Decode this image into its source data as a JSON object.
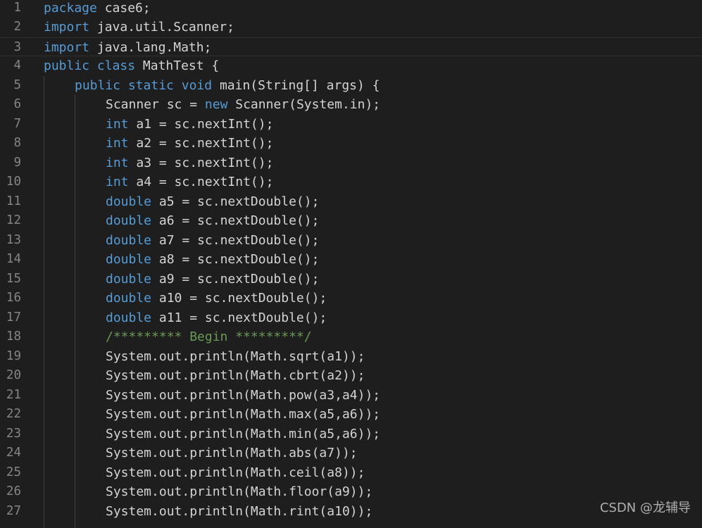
{
  "colors": {
    "background": "#1e1e1e",
    "keyword": "#569cd6",
    "text": "#d4d4d4",
    "comment": "#6a9955",
    "line_number": "#858585"
  },
  "current_line": 3,
  "lines": [
    {
      "n": "1",
      "indent": 0,
      "tokens": [
        {
          "t": "package",
          "k": "kw"
        },
        {
          "t": " case6;",
          "k": "plain"
        }
      ]
    },
    {
      "n": "2",
      "indent": 0,
      "tokens": [
        {
          "t": "import",
          "k": "kw"
        },
        {
          "t": " java.util.Scanner;",
          "k": "plain"
        }
      ]
    },
    {
      "n": "3",
      "indent": 0,
      "tokens": [
        {
          "t": "import",
          "k": "kw"
        },
        {
          "t": " java.lang.Math;",
          "k": "plain"
        }
      ]
    },
    {
      "n": "4",
      "indent": 0,
      "tokens": [
        {
          "t": "public",
          "k": "kw"
        },
        {
          "t": " ",
          "k": "plain"
        },
        {
          "t": "class",
          "k": "kw"
        },
        {
          "t": " MathTest {",
          "k": "plain"
        }
      ]
    },
    {
      "n": "5",
      "indent": 1,
      "tokens": [
        {
          "t": "public",
          "k": "kw"
        },
        {
          "t": " ",
          "k": "plain"
        },
        {
          "t": "static",
          "k": "kw"
        },
        {
          "t": " ",
          "k": "plain"
        },
        {
          "t": "void",
          "k": "kw"
        },
        {
          "t": " main(String[] args) {",
          "k": "plain"
        }
      ]
    },
    {
      "n": "6",
      "indent": 2,
      "tokens": [
        {
          "t": "Scanner sc = ",
          "k": "plain"
        },
        {
          "t": "new",
          "k": "kw"
        },
        {
          "t": " Scanner(System.in);",
          "k": "plain"
        }
      ]
    },
    {
      "n": "7",
      "indent": 2,
      "tokens": [
        {
          "t": "int",
          "k": "kw"
        },
        {
          "t": " a1 = sc.nextInt();",
          "k": "plain"
        }
      ]
    },
    {
      "n": "8",
      "indent": 2,
      "tokens": [
        {
          "t": "int",
          "k": "kw"
        },
        {
          "t": " a2 = sc.nextInt();",
          "k": "plain"
        }
      ]
    },
    {
      "n": "9",
      "indent": 2,
      "tokens": [
        {
          "t": "int",
          "k": "kw"
        },
        {
          "t": " a3 = sc.nextInt();",
          "k": "plain"
        }
      ]
    },
    {
      "n": "10",
      "indent": 2,
      "tokens": [
        {
          "t": "int",
          "k": "kw"
        },
        {
          "t": " a4 = sc.nextInt();",
          "k": "plain"
        }
      ]
    },
    {
      "n": "11",
      "indent": 2,
      "tokens": [
        {
          "t": "double",
          "k": "kw"
        },
        {
          "t": " a5 = sc.nextDouble();",
          "k": "plain"
        }
      ]
    },
    {
      "n": "12",
      "indent": 2,
      "tokens": [
        {
          "t": "double",
          "k": "kw"
        },
        {
          "t": " a6 = sc.nextDouble();",
          "k": "plain"
        }
      ]
    },
    {
      "n": "13",
      "indent": 2,
      "tokens": [
        {
          "t": "double",
          "k": "kw"
        },
        {
          "t": " a7 = sc.nextDouble();",
          "k": "plain"
        }
      ]
    },
    {
      "n": "14",
      "indent": 2,
      "tokens": [
        {
          "t": "double",
          "k": "kw"
        },
        {
          "t": " a8 = sc.nextDouble();",
          "k": "plain"
        }
      ]
    },
    {
      "n": "15",
      "indent": 2,
      "tokens": [
        {
          "t": "double",
          "k": "kw"
        },
        {
          "t": " a9 = sc.nextDouble();",
          "k": "plain"
        }
      ]
    },
    {
      "n": "16",
      "indent": 2,
      "tokens": [
        {
          "t": "double",
          "k": "kw"
        },
        {
          "t": " a10 = sc.nextDouble();",
          "k": "plain"
        }
      ]
    },
    {
      "n": "17",
      "indent": 2,
      "tokens": [
        {
          "t": "double",
          "k": "kw"
        },
        {
          "t": " a11 = sc.nextDouble();",
          "k": "plain"
        }
      ]
    },
    {
      "n": "18",
      "indent": 2,
      "tokens": [
        {
          "t": "/********* Begin *********/",
          "k": "comment"
        }
      ]
    },
    {
      "n": "19",
      "indent": 2,
      "tokens": [
        {
          "t": "System.out.println(Math.sqrt(a1));",
          "k": "plain"
        }
      ]
    },
    {
      "n": "20",
      "indent": 2,
      "tokens": [
        {
          "t": "System.out.println(Math.cbrt(a2));",
          "k": "plain"
        }
      ]
    },
    {
      "n": "21",
      "indent": 2,
      "tokens": [
        {
          "t": "System.out.println(Math.pow(a3,a4));",
          "k": "plain"
        }
      ]
    },
    {
      "n": "22",
      "indent": 2,
      "tokens": [
        {
          "t": "System.out.println(Math.max(a5,a6));",
          "k": "plain"
        }
      ]
    },
    {
      "n": "23",
      "indent": 2,
      "tokens": [
        {
          "t": "System.out.println(Math.min(a5,a6));",
          "k": "plain"
        }
      ]
    },
    {
      "n": "24",
      "indent": 2,
      "tokens": [
        {
          "t": "System.out.println(Math.abs(a7));",
          "k": "plain"
        }
      ]
    },
    {
      "n": "25",
      "indent": 2,
      "tokens": [
        {
          "t": "System.out.println(Math.ceil(a8));",
          "k": "plain"
        }
      ]
    },
    {
      "n": "26",
      "indent": 2,
      "tokens": [
        {
          "t": "System.out.println(Math.floor(a9));",
          "k": "plain"
        }
      ]
    },
    {
      "n": "27",
      "indent": 2,
      "tokens": [
        {
          "t": "System.out.println(Math.rint(a10));",
          "k": "plain"
        }
      ]
    }
  ],
  "watermark": "CSDN @龙辅导"
}
